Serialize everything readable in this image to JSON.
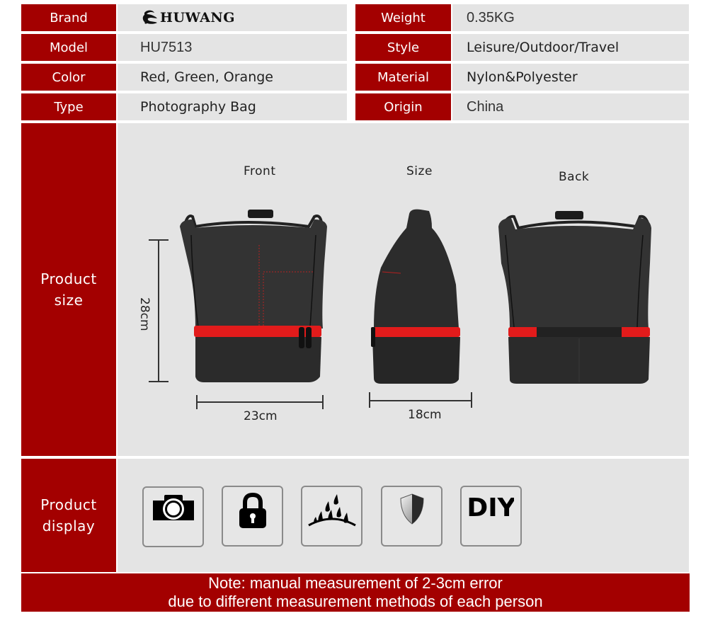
{
  "specs": {
    "left": [
      {
        "label": "Brand",
        "value": "HUWANG",
        "is_logo": true
      },
      {
        "label": "Model",
        "value": "HU7513"
      },
      {
        "label": "Color",
        "value": "Red, Green, Orange"
      },
      {
        "label": "Type",
        "value": "Photography Bag"
      }
    ],
    "right": [
      {
        "label": "Weight",
        "value": "0.35KG"
      },
      {
        "label": "Style",
        "value": "Leisure/Outdoor/Travel"
      },
      {
        "label": "Material",
        "value": "Nylon&Polyester"
      },
      {
        "label": "Origin",
        "value": "China"
      }
    ]
  },
  "product_size": {
    "section_label_line1": "Product",
    "section_label_line2": "size",
    "views": {
      "front": "Front",
      "side": "Size",
      "back": "Back"
    },
    "dimensions": {
      "height": "28cm",
      "width": "23cm",
      "depth": "18cm"
    }
  },
  "product_display": {
    "section_label_line1": "Product",
    "section_label_line2": "display",
    "features": [
      {
        "icon": "camera-icon"
      },
      {
        "icon": "padlock-icon"
      },
      {
        "icon": "waterproof-rain-icon"
      },
      {
        "icon": "shield-icon"
      },
      {
        "icon": "diy-icon",
        "text": "DIY"
      }
    ]
  },
  "note": {
    "line1": "Note: manual measurement of 2-3cm error",
    "line2": "due to different measurement methods of each person"
  },
  "colors": {
    "accent_red": "#a30000",
    "panel_gray": "#e4e4e4",
    "bag_body": "#2e2e2e",
    "zipper_red": "#e21b1b"
  }
}
